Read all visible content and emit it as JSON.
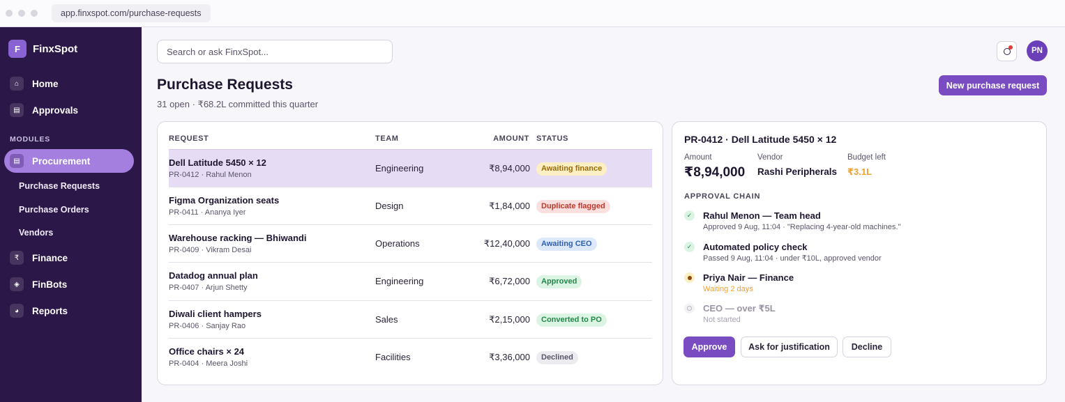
{
  "browser": {
    "url": "app.finxspot.com/purchase-requests"
  },
  "sidebar": {
    "brand_initial": "F",
    "brand_name": "FinxSpot",
    "top_items": [
      {
        "label": "Home",
        "icon": "home-icon",
        "glyph": "⌂"
      },
      {
        "label": "Approvals",
        "icon": "approvals-icon",
        "glyph": "▤"
      }
    ],
    "section_label": "MODULES",
    "active_item": {
      "label": "Procurement",
      "icon": "procurement-icon",
      "glyph": "▤"
    },
    "sub_items": [
      "Purchase Requests",
      "Purchase Orders",
      "Vendors"
    ],
    "bottom_items": [
      {
        "label": "Finance",
        "icon": "rupee-icon",
        "glyph": "₹"
      },
      {
        "label": "FinBots",
        "icon": "bot-icon",
        "glyph": "◈"
      },
      {
        "label": "Reports",
        "icon": "pie-chart-icon",
        "glyph": "◕"
      }
    ]
  },
  "header": {
    "search_placeholder": "Search or ask FinxSpot...",
    "avatar_initials": "PN"
  },
  "page": {
    "title": "Purchase Requests",
    "subtitle": "31 open · ₹68.2L committed this quarter",
    "new_button": "New purchase request"
  },
  "table": {
    "columns": [
      "REQUEST",
      "TEAM",
      "AMOUNT",
      "STATUS"
    ],
    "rows": [
      {
        "title": "Dell Latitude 5450 × 12",
        "meta": "PR-0412 · Rahul Menon",
        "team": "Engineering",
        "amount": "₹8,94,000",
        "status": "Awaiting finance",
        "status_bg": "#fcefc4",
        "status_fg": "#9a6a08",
        "selected": true
      },
      {
        "title": "Figma Organization seats",
        "meta": "PR-0411 · Ananya Iyer",
        "team": "Design",
        "amount": "₹1,84,000",
        "status": "Duplicate flagged",
        "status_bg": "#fbdede",
        "status_fg": "#c0392b"
      },
      {
        "title": "Warehouse racking — Bhiwandi",
        "meta": "PR-0409 · Vikram Desai",
        "team": "Operations",
        "amount": "₹12,40,000",
        "status": "Awaiting CEO",
        "status_bg": "#dde8fb",
        "status_fg": "#2d5fb0"
      },
      {
        "title": "Datadog annual plan",
        "meta": "PR-0407 · Arjun Shetty",
        "team": "Engineering",
        "amount": "₹6,72,000",
        "status": "Approved",
        "status_bg": "#dcf4e3",
        "status_fg": "#23864a"
      },
      {
        "title": "Diwali client hampers",
        "meta": "PR-0406 · Sanjay Rao",
        "team": "Sales",
        "amount": "₹2,15,000",
        "status": "Converted to PO",
        "status_bg": "#dcf4e3",
        "status_fg": "#23864a"
      },
      {
        "title": "Office chairs × 24",
        "meta": "PR-0404 · Meera Joshi",
        "team": "Facilities",
        "amount": "₹3,36,000",
        "status": "Declined",
        "status_bg": "#ecebef",
        "status_fg": "#5b5468"
      }
    ]
  },
  "detail": {
    "title": "PR-0412 · Dell Latitude 5450 × 12",
    "amount_label": "Amount",
    "amount": "₹8,94,000",
    "vendor_label": "Vendor",
    "vendor": "Rashi Peripherals",
    "budget_label": "Budget left",
    "budget": "₹3.1L",
    "chain_label": "APPROVAL CHAIN",
    "steps": [
      {
        "name": "Rahul Menon — Team head",
        "note": "Approved 9 Aug, 11:04 · \"Replacing 4-year-old machines.\"",
        "state": "done",
        "icon": "check-icon"
      },
      {
        "name": "Automated policy check",
        "note": "Passed 9 Aug, 11:04 · under ₹10L, approved vendor",
        "state": "done",
        "icon": "check-icon"
      },
      {
        "name": "Priya Nair — Finance",
        "note": "Waiting 2 days",
        "state": "current",
        "icon": "pending-dot-icon"
      },
      {
        "name": "CEO — over ₹5L",
        "note": "Not started",
        "state": "todo",
        "icon": "empty-circle-icon"
      }
    ],
    "actions": {
      "approve": "Approve",
      "justify": "Ask for justification",
      "decline": "Decline"
    }
  },
  "colors": {
    "sidebar": "#2c1848",
    "accent": "#7a4cc2",
    "selected_row": "#e6ddf5",
    "warning": "#f0a030"
  }
}
